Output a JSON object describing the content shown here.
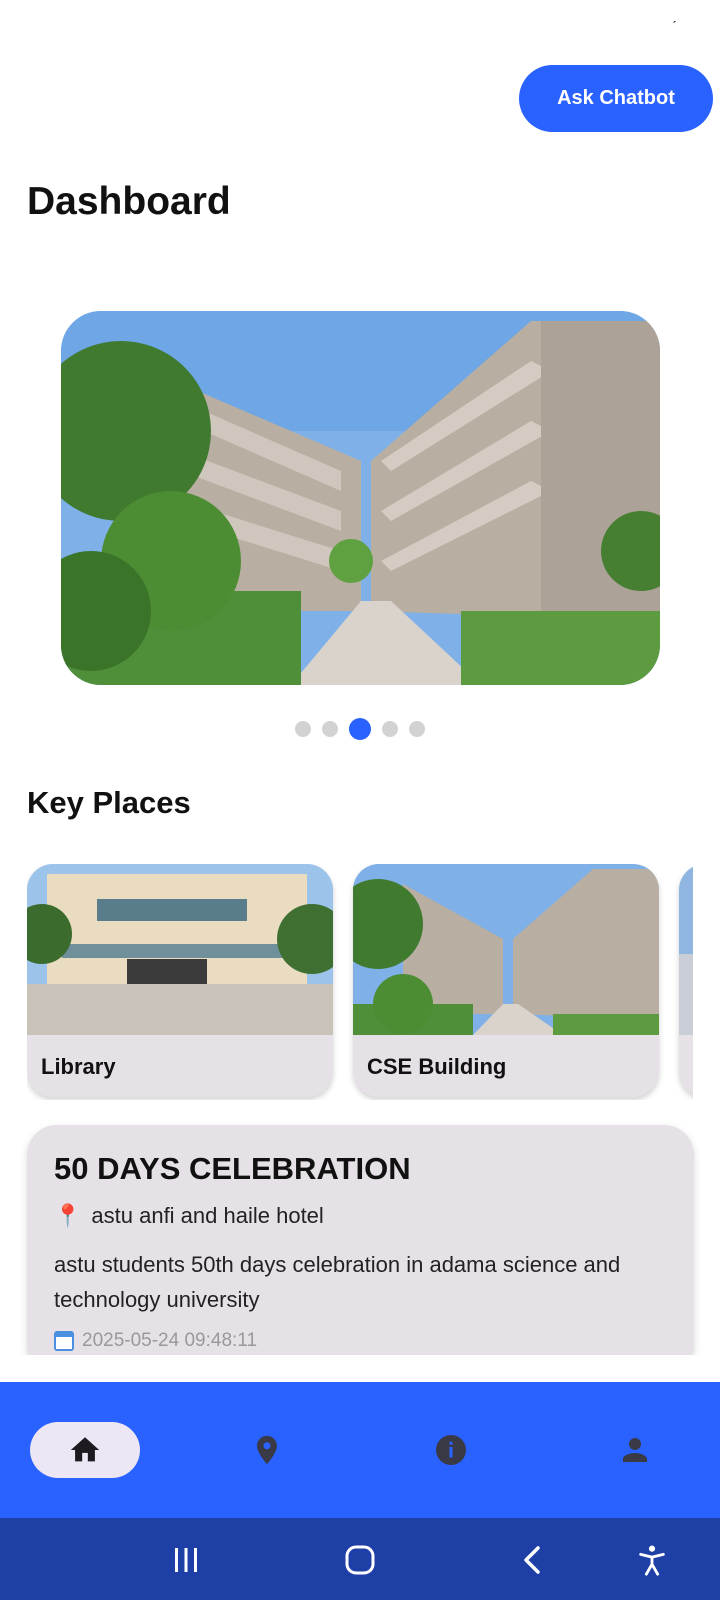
{
  "status": {
    "mark": "ˊ"
  },
  "header": {
    "chatbot_label": "Ask Chatbot",
    "title": "Dashboard"
  },
  "carousel": {
    "total": 5,
    "active_index": 2
  },
  "key_places": {
    "title": "Key Places",
    "items": [
      {
        "label": "Library"
      },
      {
        "label": "CSE Building"
      },
      {
        "label": ""
      }
    ]
  },
  "event": {
    "title": "50 DAYS CELEBRATION",
    "location_icon": "📍",
    "location": "astu anfi and haile hotel",
    "description": "astu students 50th days celebration in adama science and technology university",
    "date": "2025-05-24 09:48:11"
  },
  "bottom_nav": {
    "items": [
      {
        "name": "home",
        "icon": "home-icon",
        "active": true
      },
      {
        "name": "places",
        "icon": "location-pin-icon",
        "active": false
      },
      {
        "name": "info",
        "icon": "info-icon",
        "active": false
      },
      {
        "name": "profile",
        "icon": "person-icon",
        "active": false
      }
    ]
  },
  "colors": {
    "accent": "#2962ff",
    "nav_active_bg": "#ece6f5",
    "card_bg": "#e6e1e6",
    "system_nav": "#1e3fa6"
  }
}
